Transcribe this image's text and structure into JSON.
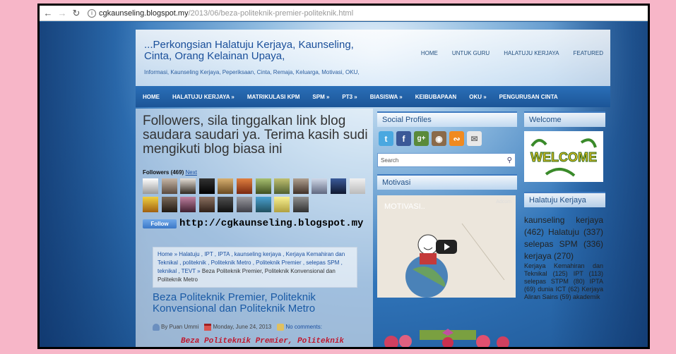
{
  "browser": {
    "url_host": "cgkaunseling.blogspot.my",
    "url_path": "/2013/06/beza-politeknik-premier-politeknik.html"
  },
  "site": {
    "title": "...Perkongsian Halatuju Kerjaya, Kaunseling, Cinta, Orang Kelainan Upaya,",
    "description": "Informasi, Kaunseling Kerjaya, Peperiksaan, Cinta, Remaja, Keluarga, Motivasi, OKU,"
  },
  "top_menu": [
    "HOME",
    "UNTUK GURU",
    "HALATUJU KERJAYA",
    "FEATURED"
  ],
  "main_nav": [
    "HOME",
    "HALATUJU KERJAYA »",
    "MATRIKULASI KPM",
    "SPM »",
    "PT3 »",
    "BIASISWA »",
    "KEIBUBAPAAN",
    "OKU »",
    "PENGURUSAN CINTA"
  ],
  "content": {
    "notice": "Followers, sila tinggalkan link blog saudara saudari ya. Terima kasih sudi mengikuti blog biasa ini",
    "followers_label": "Followers (469)",
    "next_label": "Next",
    "follow_button": "Follow",
    "blog_url": "http://cgkaunseling.blogspot.my",
    "breadcrumb_links": "Home » Halatuju , IPT , IPTA , kaunseling kerjaya , Kerjaya Kemahiran dan Teknikal , politeknik , Politeknik Metro , Politeknik Premier , selepas SPM , teknikal , TEVT »",
    "breadcrumb_current": "Beza Politeknik Premier, Politeknik Konvensional dan Politeknik Metro",
    "post_title": "Beza Politeknik Premier, Politeknik Konvensional dan Politeknik Metro",
    "author": "By Puan Ummi",
    "date": "Monday, June 24, 2013",
    "comments": "No comments:",
    "post_sub": "Beza Politeknik Premier, Politeknik"
  },
  "sidebar_mid": {
    "social_title": "Social Profiles",
    "search_placeholder": "Search",
    "motivasi_title": "Motivasi",
    "video_title": "MOTIVASI..",
    "video_corner": "Adcom"
  },
  "sidebar_right": {
    "welcome_title": "Welcome",
    "welcome_image_text": "WELCOME",
    "halatuju_title": "Halatuju Kerjaya",
    "tags_large": "kaunseling kerjaya (462) Halatuju (337) selepas SPM (336) kerjaya (270)",
    "tags_small": "Kerjaya Kemahiran dan Teknikal (125) IPT (113) selepas STPM (80) IPTA (69) dunia ICT (62) Kerjaya Aliran Sains (59) akademik"
  },
  "colors": {
    "page_background": "#f7b6c8",
    "nav_blue": "#1c5597",
    "title_blue": "#1a4f9a",
    "post_sub_red": "#c0182e"
  }
}
